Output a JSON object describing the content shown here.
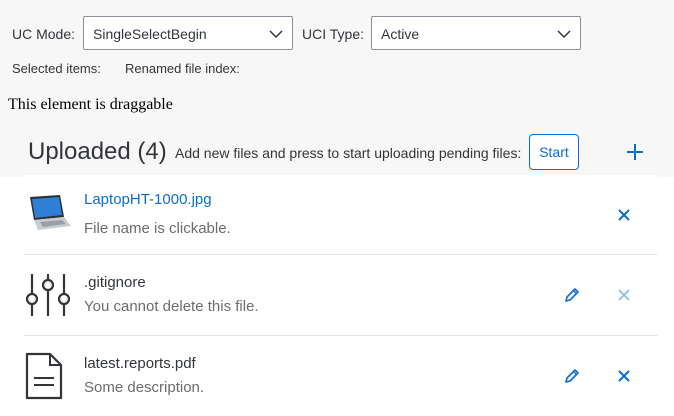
{
  "controls": {
    "uc_mode_label": "UC Mode:",
    "uc_mode_value": "SingleSelectBegin",
    "uci_type_label": "UCI Type:",
    "uci_type_value": "Active",
    "selected_items_label": "Selected items:",
    "renamed_index_label": "Renamed file index:"
  },
  "draggable_text": "This element is draggable",
  "upload": {
    "title": "Uploaded (4)",
    "hint": "Add new files and press to start uploading pending files:",
    "start_label": "Start"
  },
  "items": [
    {
      "name": "LaptopHT-1000.jpg",
      "description": "File name is clickable.",
      "icon": "laptop-thumbnail",
      "editable": false,
      "deletable": true
    },
    {
      "name": ".gitignore",
      "description": "You cannot delete this file.",
      "icon": "settings-sliders-icon",
      "editable": true,
      "deletable": false
    },
    {
      "name": "latest.reports.pdf",
      "description": "Some description.",
      "icon": "document-icon",
      "editable": true,
      "deletable": true
    }
  ],
  "colors": {
    "accent": "#0a6ed1",
    "text": "#32363a",
    "secondary_text": "#6a6d70",
    "disabled_icon": "#8fbde8",
    "background": "#f7f7f7"
  }
}
